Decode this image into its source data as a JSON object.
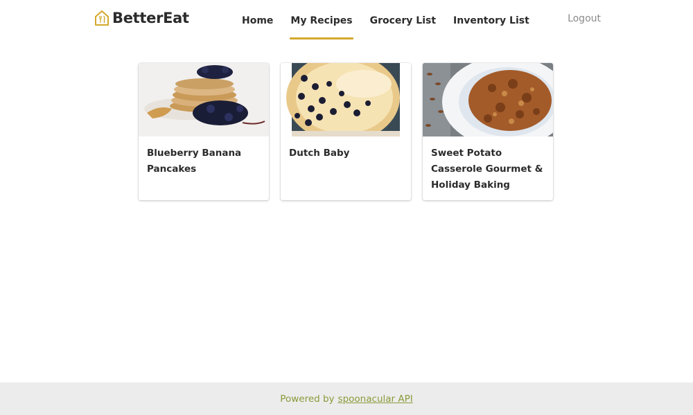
{
  "brand": {
    "name": "BetterEat",
    "icon": "house-fork-icon",
    "accent": "#d4a72c"
  },
  "nav": {
    "items": [
      {
        "label": "Home",
        "active": false
      },
      {
        "label": "My Recipes",
        "active": true
      },
      {
        "label": "Grocery List",
        "active": false
      },
      {
        "label": "Inventory List",
        "active": false
      }
    ],
    "logout": "Logout"
  },
  "recipes": [
    {
      "title": "Blueberry Banana Pancakes"
    },
    {
      "title": "Dutch Baby"
    },
    {
      "title": "Sweet Potato Casserole Gourmet & Holiday Baking"
    }
  ],
  "footer": {
    "prefix": "Powered by",
    "link": "spoonacular API",
    "color": "#8a9a3a"
  }
}
